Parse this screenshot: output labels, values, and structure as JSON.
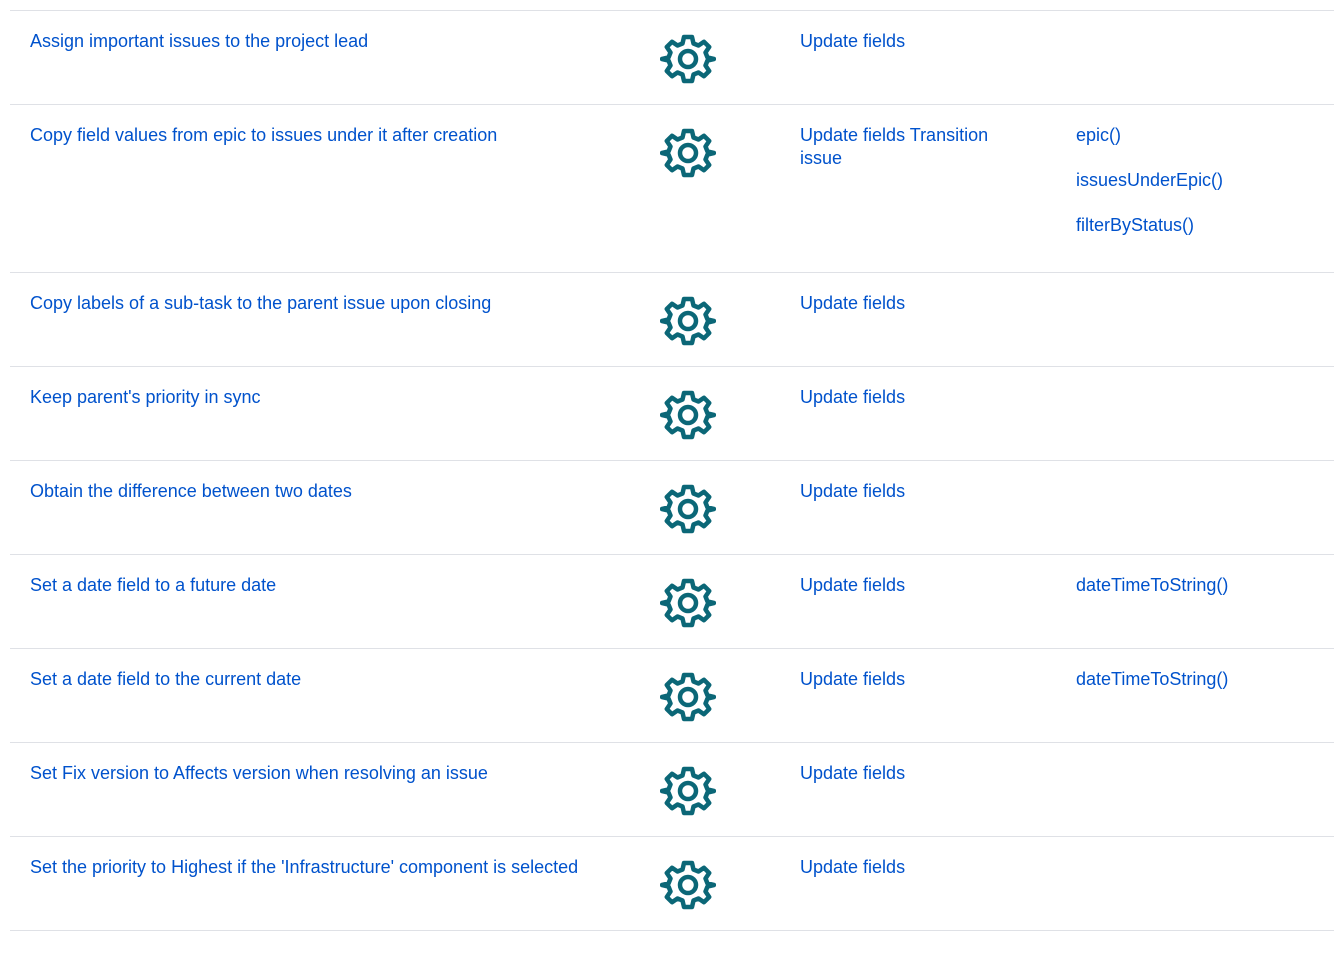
{
  "colors": {
    "link": "#0052cc",
    "icon": "#0b6777",
    "divider": "#dfe1e6"
  },
  "icon_name": "gear-icon",
  "rows": [
    {
      "title": "Assign important issues to the project lead",
      "action": "Update fields",
      "functions": []
    },
    {
      "title": "Copy field values from epic to issues under it after creation",
      "action": "Update fields Transition issue",
      "functions": [
        "epic()",
        "issuesUnderEpic()",
        "filterByStatus()"
      ]
    },
    {
      "title": "Copy labels of a sub-task to the parent issue upon closing",
      "action": "Update fields",
      "functions": []
    },
    {
      "title": "Keep parent's priority in sync",
      "action": "Update fields",
      "functions": []
    },
    {
      "title": "Obtain the difference between two dates",
      "action": "Update fields",
      "functions": []
    },
    {
      "title": "Set a date field to a future date",
      "action": "Update fields",
      "functions": [
        "dateTimeToString()"
      ]
    },
    {
      "title": "Set a date field to the current date",
      "action": "Update fields",
      "functions": [
        "dateTimeToString()"
      ]
    },
    {
      "title": "Set Fix version to Affects version when resolving an issue",
      "action": "Update fields",
      "functions": []
    },
    {
      "title": "Set the priority to Highest if the 'Infrastructure' component is selected",
      "action": "Update fields",
      "functions": []
    }
  ]
}
